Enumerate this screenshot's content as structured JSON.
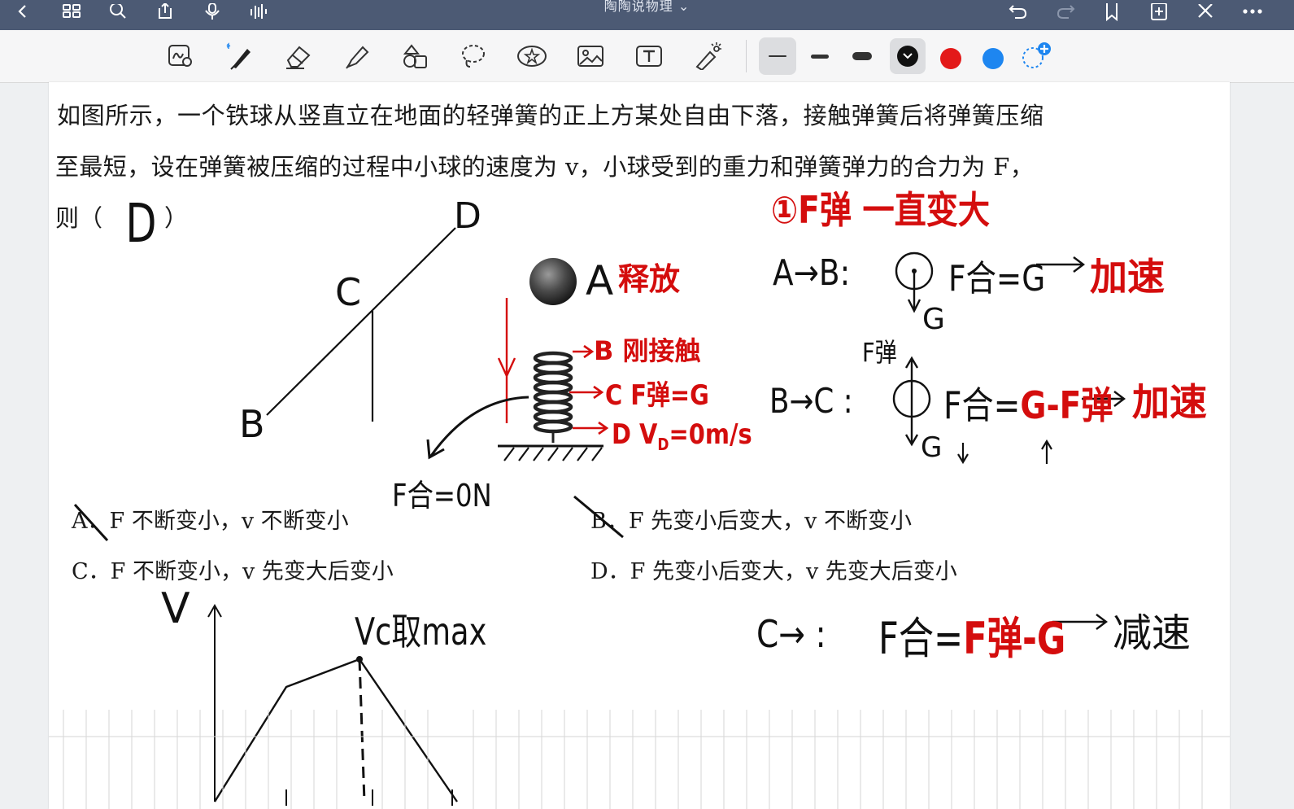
{
  "app": {
    "title": "陶陶说物理",
    "title_caret": "⌄"
  },
  "colors": {
    "topbar": "#4c5a74",
    "ink_black": "#111111",
    "ink_red": "#d40d0d",
    "ink_blue": "#1e86f0"
  },
  "toolbar": {
    "tools": [
      "handwriting-lasso",
      "pen",
      "eraser",
      "highlighter",
      "shapes",
      "lasso",
      "sticker",
      "image",
      "text",
      "laser-pointer"
    ],
    "stroke_widths": [
      "thin",
      "medium",
      "thick"
    ],
    "colors": [
      "#111111",
      "#d40d0d",
      "#1e86f0"
    ]
  },
  "question": {
    "line1": "如图所示，一个铁球从竖直立在地面的轻弹簧的正上方某处自由下落，接触弹簧后将弹簧压缩",
    "line2": "至最短，设在弹簧被压缩的过程中小球的速度为 v，小球受到的重力和弹簧弹力的合力为 F，",
    "line3_prefix": "则（",
    "line3_suffix": "）"
  },
  "options": {
    "A": "A．F 不断变小，v 不断变小",
    "B": "B．F 先变小后变大，v 不断变小",
    "C": "C．F 不断变小，v 先变大后变小",
    "D": "D．F 先变小后变大，v 先变大后变小"
  },
  "notes": {
    "answer": "D",
    "graph_D": "D",
    "graph_C": "C",
    "graph_B": "B",
    "ball_A": "A",
    "release": "释放",
    "contact_B": "B 刚接触",
    "balance_C": "C F弹=G",
    "bottom_D": "D  V",
    "bottom_D_sub": "D",
    "bottom_D_val": "=0m/s",
    "f_zero": "F合=0N",
    "rule1_num": "①",
    "rule1": "F弹 一直变大",
    "ab_label": "A→B:",
    "ab_eq": "F合=G",
    "ab_result": "加速",
    "ab_g": "G",
    "bc_label": "B→C :",
    "bc_eq_black": "F合=",
    "bc_eq_red": "G-F弹",
    "bc_result": "加速",
    "bc_fspring": "F弹",
    "bc_g": "G",
    "c_label": "C→ :",
    "c_eq_black": "F合=",
    "c_eq_red": "F弹-G",
    "c_result": "减速",
    "vt_v": "V",
    "vt_peak": "Vc取max"
  }
}
